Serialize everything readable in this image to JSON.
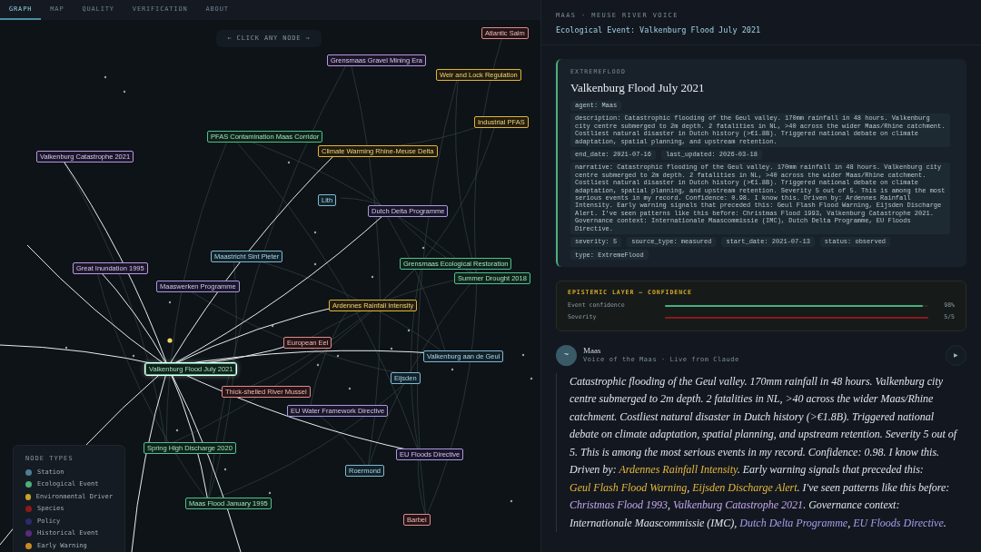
{
  "tabs": [
    {
      "label": "GRAPH",
      "selected": true
    },
    {
      "label": "MAP",
      "selected": false
    },
    {
      "label": "QUALITY",
      "selected": false
    },
    {
      "label": "VERIFICATION",
      "selected": false
    },
    {
      "label": "ABOUT",
      "selected": false
    }
  ],
  "graph": {
    "hint": "← CLICK ANY NODE →",
    "nodes": [
      {
        "label": "Atlantic Salm",
        "kind": "species",
        "selected": false
      },
      {
        "label": "Grensmaas Gravel Mining Era",
        "kind": "historical",
        "selected": false
      },
      {
        "label": "Weir and Lock Regulation",
        "kind": "driver",
        "selected": false
      },
      {
        "label": "Industrial PFAS",
        "kind": "driver",
        "selected": false
      },
      {
        "label": "PFAS Contamination Maas Corridor",
        "kind": "ecological",
        "selected": false
      },
      {
        "label": "Climate Warming Rhine-Meuse Delta",
        "kind": "driver",
        "selected": false
      },
      {
        "label": "Valkenburg Catastrophe 2021",
        "kind": "historical",
        "selected": false
      },
      {
        "label": "Lith",
        "kind": "station",
        "selected": false
      },
      {
        "label": "Dutch Delta Programme",
        "kind": "policy",
        "selected": false
      },
      {
        "label": "Maastricht Sint Pieter",
        "kind": "station",
        "selected": false
      },
      {
        "label": "Great Inundation 1995",
        "kind": "historical",
        "selected": false
      },
      {
        "label": "Maaswerken Programme",
        "kind": "policy",
        "selected": false
      },
      {
        "label": "Grensmaas Ecological Restoration",
        "kind": "ecological",
        "selected": false
      },
      {
        "label": "Summer Drought 2018",
        "kind": "ecological",
        "selected": false
      },
      {
        "label": "Ardennes Rainfall Intensity",
        "kind": "driver",
        "selected": false
      },
      {
        "label": "European Eel",
        "kind": "species",
        "selected": false
      },
      {
        "label": "Valkenburg aan de Geul",
        "kind": "station",
        "selected": false
      },
      {
        "label": "Valkenburg Flood July 2021",
        "kind": "ecological",
        "selected": true
      },
      {
        "label": "Eijsden",
        "kind": "station",
        "selected": false
      },
      {
        "label": "Thick-shelled River Mussel",
        "kind": "species",
        "selected": false
      },
      {
        "label": "EU Water Framework Directive",
        "kind": "policy",
        "selected": false
      },
      {
        "label": "Spring High Discharge 2020",
        "kind": "ecological",
        "selected": false
      },
      {
        "label": "EU Floods Directive",
        "kind": "policy",
        "selected": false
      },
      {
        "label": "Roermond",
        "kind": "station",
        "selected": false
      },
      {
        "label": "Maas Flood January 1995",
        "kind": "ecological",
        "selected": false
      },
      {
        "label": "Barbel",
        "kind": "species",
        "selected": false
      }
    ],
    "legend": {
      "title": "NODE TYPES",
      "items": [
        {
          "label": "Station",
          "color": "#4a7f94"
        },
        {
          "label": "Ecological Event",
          "color": "#4caf7a"
        },
        {
          "label": "Environmental Driver",
          "color": "#c9a227"
        },
        {
          "label": "Species",
          "color": "#8b1a1a"
        },
        {
          "label": "Policy",
          "color": "#2e2a6e"
        },
        {
          "label": "Historical Event",
          "color": "#5b2a7e"
        },
        {
          "label": "Early Warning",
          "color": "#c98a22"
        }
      ]
    }
  },
  "panel": {
    "eyebrow": "MAAS · MEUSE RIVER VOICE",
    "subtitle": "Ecological Event: Valkenburg Flood July 2021",
    "card": {
      "type_label": "EXTREMEFLOOD",
      "title": "Valkenburg Flood July 2021",
      "properties": [
        [
          "agent: Maas"
        ],
        [
          "description: Catastrophic flooding of the Geul valley. 170mm rainfall in 48 hours. Valkenburg city centre submerged to 2m depth. 2 fatalities in NL, >40 across the wider Maas/Rhine catchment. Costliest natural disaster in Dutch history (>€1.8B). Triggered national debate on climate adaptation, spatial planning, and upstream retention."
        ],
        [
          "end_date: 2021-07-16",
          "last_updated: 2026-03-18"
        ],
        [
          "narrative: Catastrophic flooding of the Geul valley. 170mm rainfall in 48 hours. Valkenburg city centre submerged to 2m depth. 2 fatalities in NL, >40 across the wider Maas/Rhine catchment. Costliest natural disaster in Dutch history (>€1.8B). Triggered national debate on climate adaptation, spatial planning, and upstream retention. Severity 5 out of 5. This is among the most serious events in my record. Confidence: 0.98. I know this. Driven by: Ardennes Rainfall Intensity. Early warning signals that preceded this: Geul Flash Flood Warning, Eijsden Discharge Alert. I've seen patterns like this before: Christmas Flood 1993, Valkenburg Catastrophe 2021. Governance context: Internationale Maascommissie (IMC), Dutch Delta Programme, EU Floods Directive."
        ],
        [
          "severity: 5",
          "source_type: measured",
          "start_date: 2021-07-13",
          "status: observed"
        ],
        [
          "type: ExtremeFlood"
        ]
      ]
    },
    "epistemic": {
      "title": "EPISTEMIC LAYER — CONFIDENCE",
      "meters": [
        {
          "label": "Event confidence",
          "level": 0.98,
          "reading": "98%",
          "kind": "confidence"
        },
        {
          "label": "Severity",
          "level": 1.0,
          "reading": "5/5",
          "kind": "severity"
        }
      ]
    },
    "voice": {
      "avatar": "~",
      "name": "Maas",
      "meta": "Voice of the Maas · Live from Claude",
      "play": "▶",
      "segments": [
        {
          "kind": "plain",
          "text": "Catastrophic flooding of the Geul valley. 170mm rainfall in 48 hours. Valkenburg city centre submerged to 2m depth. 2 fatalities in NL, >40 across the wider Maas/Rhine catchment. Costliest natural disaster in Dutch history (>€1.8B). Triggered national debate on climate adaptation, spatial planning, and upstream retention. Severity 5 out of 5. This is among the most serious events in my record. Confidence: 0.98. I know this. Driven by: "
        },
        {
          "kind": "driver",
          "text": "Ardennes Rainfall Intensity"
        },
        {
          "kind": "plain",
          "text": ". Early warning signals that preceded this: "
        },
        {
          "kind": "driver",
          "text": "Geul Flash Flood Warning"
        },
        {
          "kind": "plain",
          "text": ", "
        },
        {
          "kind": "driver",
          "text": "Eijsden Discharge Alert"
        },
        {
          "kind": "plain",
          "text": ". I've seen patterns like this before: "
        },
        {
          "kind": "historical",
          "text": "Christmas Flood 1993"
        },
        {
          "kind": "plain",
          "text": ", "
        },
        {
          "kind": "historical",
          "text": "Valkenburg Catastrophe 2021"
        },
        {
          "kind": "plain",
          "text": ". Governance context: Internationale Maascommissie (IMC), "
        },
        {
          "kind": "policy",
          "text": "Dutch Delta Programme"
        },
        {
          "kind": "plain",
          "text": ", "
        },
        {
          "kind": "policy",
          "text": "EU Floods Directive"
        },
        {
          "kind": "plain",
          "text": "."
        }
      ]
    }
  }
}
